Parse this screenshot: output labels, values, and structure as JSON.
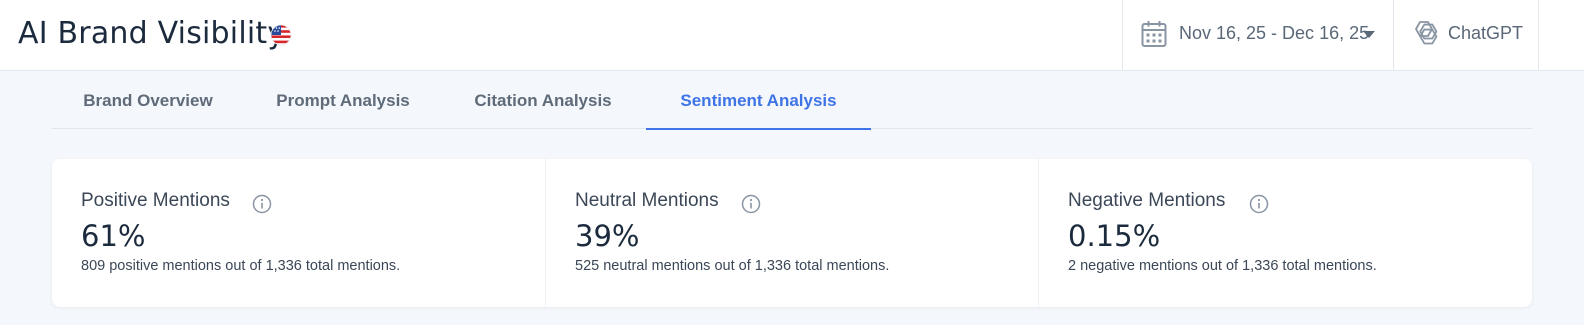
{
  "header": {
    "title": "AI Brand Visibility",
    "flag_icon": "us-flag-icon",
    "date_range": "Nov 16, 25 - Dec 16, 25",
    "model": "ChatGPT"
  },
  "tabs": [
    {
      "label": "Brand Overview",
      "active": false
    },
    {
      "label": "Prompt Analysis",
      "active": false
    },
    {
      "label": "Citation Analysis",
      "active": false
    },
    {
      "label": "Sentiment Analysis",
      "active": true
    }
  ],
  "cards": [
    {
      "title": "Positive Mentions",
      "value": "61%",
      "subtitle": "809 positive mentions out of 1,336 total mentions."
    },
    {
      "title": "Neutral Mentions",
      "value": "39%",
      "subtitle": "525 neutral mentions out of 1,336 total mentions."
    },
    {
      "title": "Negative Mentions",
      "value": "0.15%",
      "subtitle": "2 negative mentions out of 1,336 total mentions."
    }
  ],
  "colors": {
    "accent": "#3f74e6",
    "background": "#f4f7fb",
    "text_primary": "#1b2a3d",
    "text_muted": "#5a6778"
  }
}
